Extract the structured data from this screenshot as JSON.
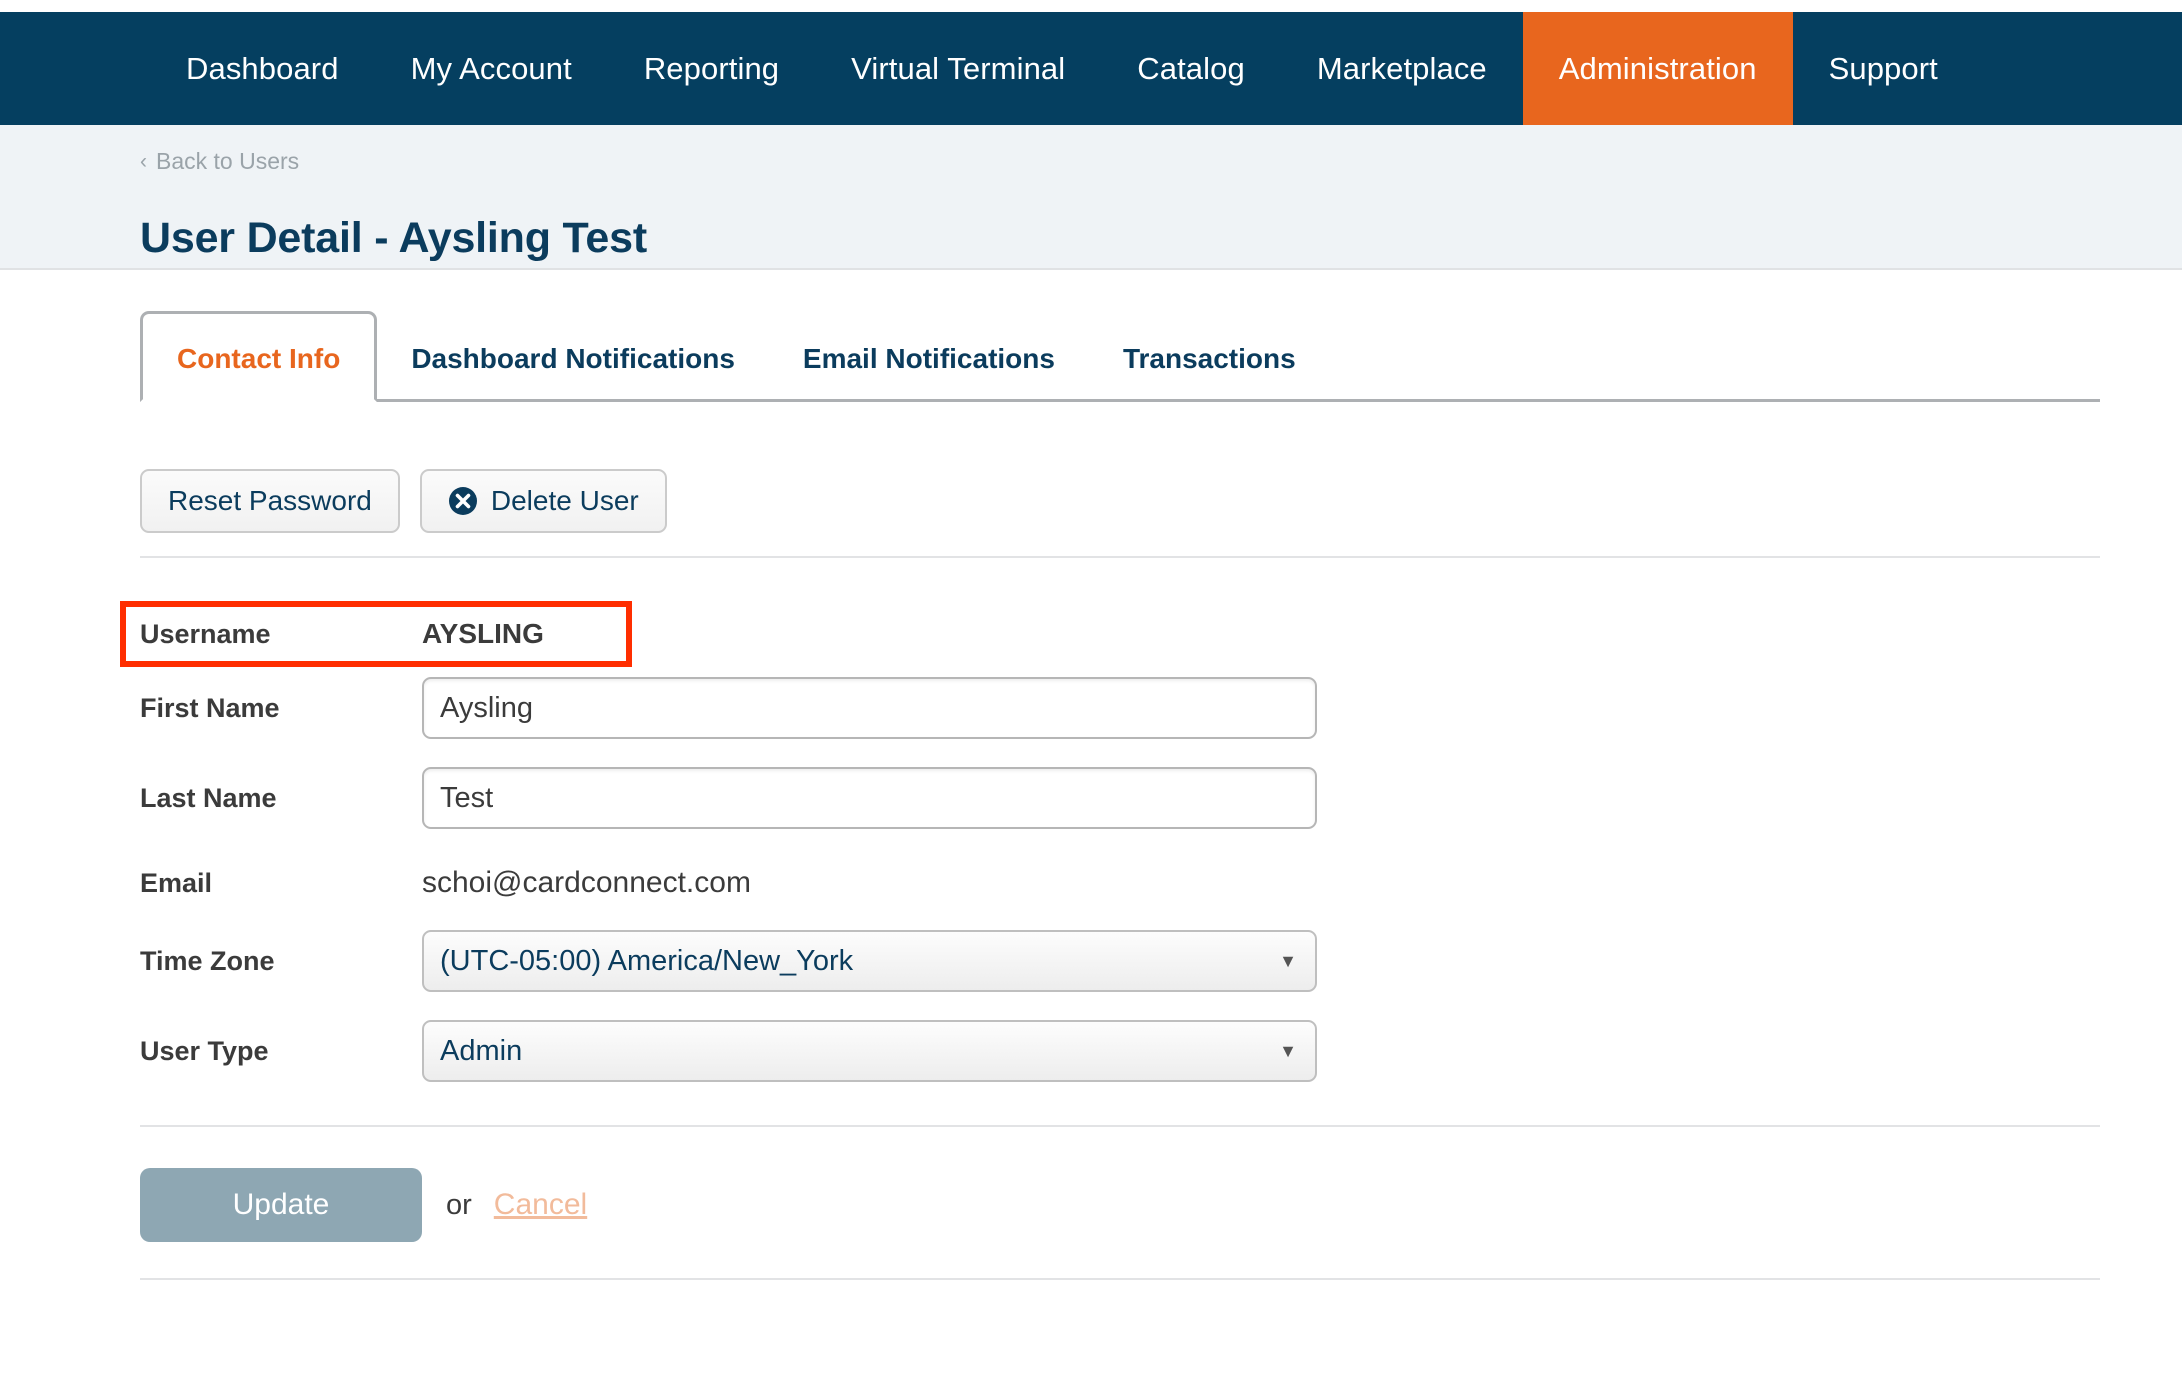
{
  "nav": {
    "items": [
      {
        "label": "Dashboard",
        "active": false
      },
      {
        "label": "My Account",
        "active": false
      },
      {
        "label": "Reporting",
        "active": false
      },
      {
        "label": "Virtual Terminal",
        "active": false
      },
      {
        "label": "Catalog",
        "active": false
      },
      {
        "label": "Marketplace",
        "active": false
      },
      {
        "label": "Administration",
        "active": true
      },
      {
        "label": "Support",
        "active": false
      }
    ],
    "active_bg": "#E8661E",
    "bar_bg": "#053F60"
  },
  "header": {
    "breadcrumb_chevron": "chevron-left-icon",
    "breadcrumb_label": "Back to Users",
    "title": "User Detail - Aysling Test",
    "band_bg": "#EFF3F6",
    "title_color": "#0B3C5D"
  },
  "tabs": [
    {
      "label": "Contact Info",
      "active": true
    },
    {
      "label": "Dashboard Notifications",
      "active": false
    },
    {
      "label": "Email Notifications",
      "active": false
    },
    {
      "label": "Transactions",
      "active": false
    }
  ],
  "actions": {
    "reset_password": "Reset Password",
    "delete_user": "Delete User",
    "delete_icon": "circle-x-icon"
  },
  "form": {
    "username": {
      "label": "Username",
      "value": "AYSLING",
      "highlighted": true,
      "highlight_color": "#FF2E00"
    },
    "first_name": {
      "label": "First Name",
      "value": "Aysling",
      "placeholder": ""
    },
    "last_name": {
      "label": "Last Name",
      "value": "Test",
      "placeholder": ""
    },
    "email": {
      "label": "Email",
      "value": "schoi@cardconnect.com"
    },
    "time_zone": {
      "label": "Time Zone",
      "value": "(UTC-05:00) America/New_York",
      "caret": "caret-down-icon"
    },
    "user_type": {
      "label": "User Type",
      "value": "Admin",
      "caret": "caret-down-icon"
    }
  },
  "footer": {
    "update_label": "Update",
    "or_label": "or",
    "cancel_label": "Cancel",
    "update_bg": "#8EA7B3",
    "cancel_color": "#F2BB9B"
  }
}
